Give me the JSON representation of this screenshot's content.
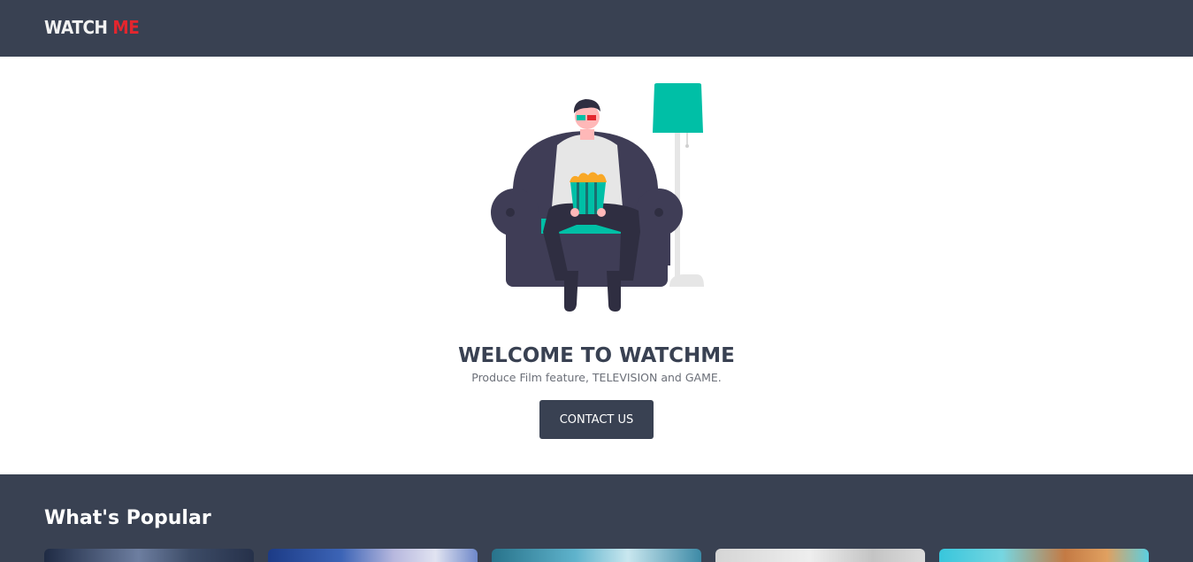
{
  "navbar": {
    "logo_part1": "WATCH",
    "logo_part2": "ME"
  },
  "hero": {
    "illustration": "person-watching-movie-illustration",
    "title": "WELCOME TO WATCHME",
    "subtitle": "Produce Film feature, TELEVISION and GAME.",
    "cta_label": "CONTACT US"
  },
  "popular": {
    "heading": "What's Popular",
    "posters": [
      {
        "image": "poster-1-image"
      },
      {
        "image": "poster-2-image"
      },
      {
        "image": "poster-3-image"
      },
      {
        "image": "poster-4-image"
      },
      {
        "image": "poster-5-image"
      }
    ]
  },
  "colors": {
    "navbar_bg": "#394152",
    "accent_red": "#e3262e",
    "accent_teal": "#00bfa6",
    "button_bg": "#394152",
    "hero_bg": "#ffffff"
  }
}
